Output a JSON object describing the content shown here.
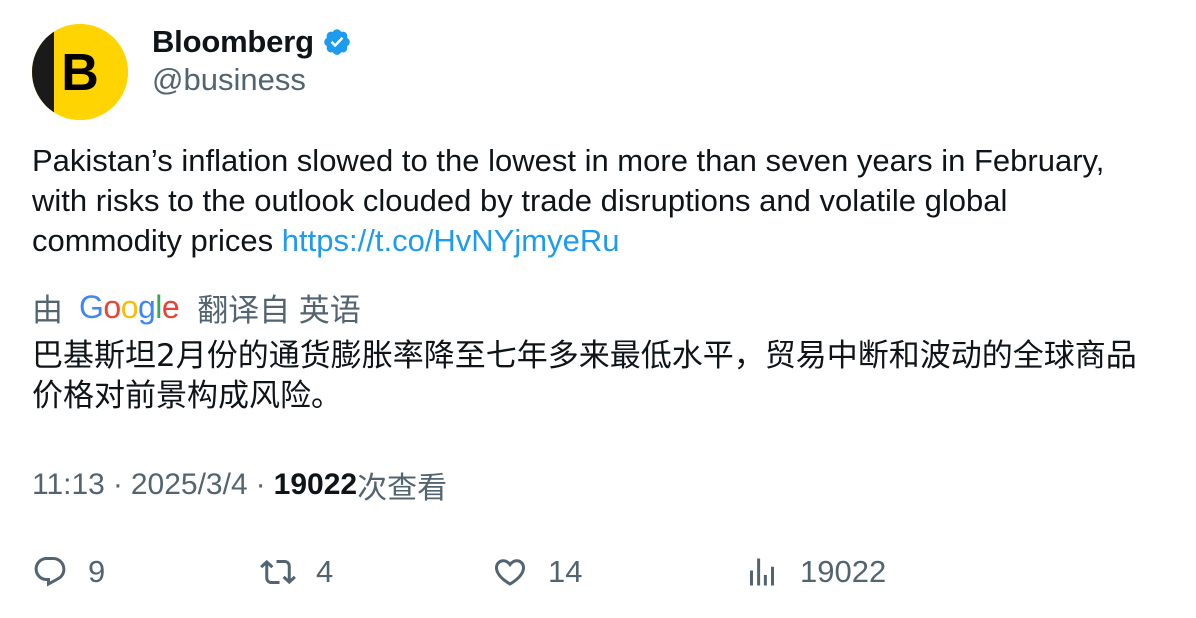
{
  "author": {
    "display_name": "Bloomberg",
    "handle": "@business",
    "verified": true,
    "avatar_letter": "B",
    "avatar_color": "#ffd400",
    "verified_color": "#1d9bf0"
  },
  "tweet": {
    "text": "Pakistan’s inflation slowed to the lowest in more than seven years in February, with risks to the outlook clouded by trade disruptions and volatile global commodity prices ",
    "link": "https://t.co/HvNYjmyeRu"
  },
  "translation": {
    "prefix": "由",
    "provider_letters": [
      "G",
      "o",
      "o",
      "g",
      "l",
      "e"
    ],
    "provider_colors": [
      "#4285f4",
      "#ea4335",
      "#fbbc05",
      "#4285f4",
      "#34a853",
      "#ea4335"
    ],
    "suffix": "翻译自 英语",
    "text": "巴基斯坦2月份的通货膨胀率降至七年多来最低水平，贸易中断和波动的全球商品价格对前景构成风险。"
  },
  "meta": {
    "time": "11:13",
    "separator": "·",
    "date": "2025/3/4",
    "views_count": "19022",
    "views_label": "次查看"
  },
  "actions": {
    "reply_count": "9",
    "retweet_count": "4",
    "like_count": "14",
    "views_count": "19022",
    "icon_color": "#536471"
  }
}
